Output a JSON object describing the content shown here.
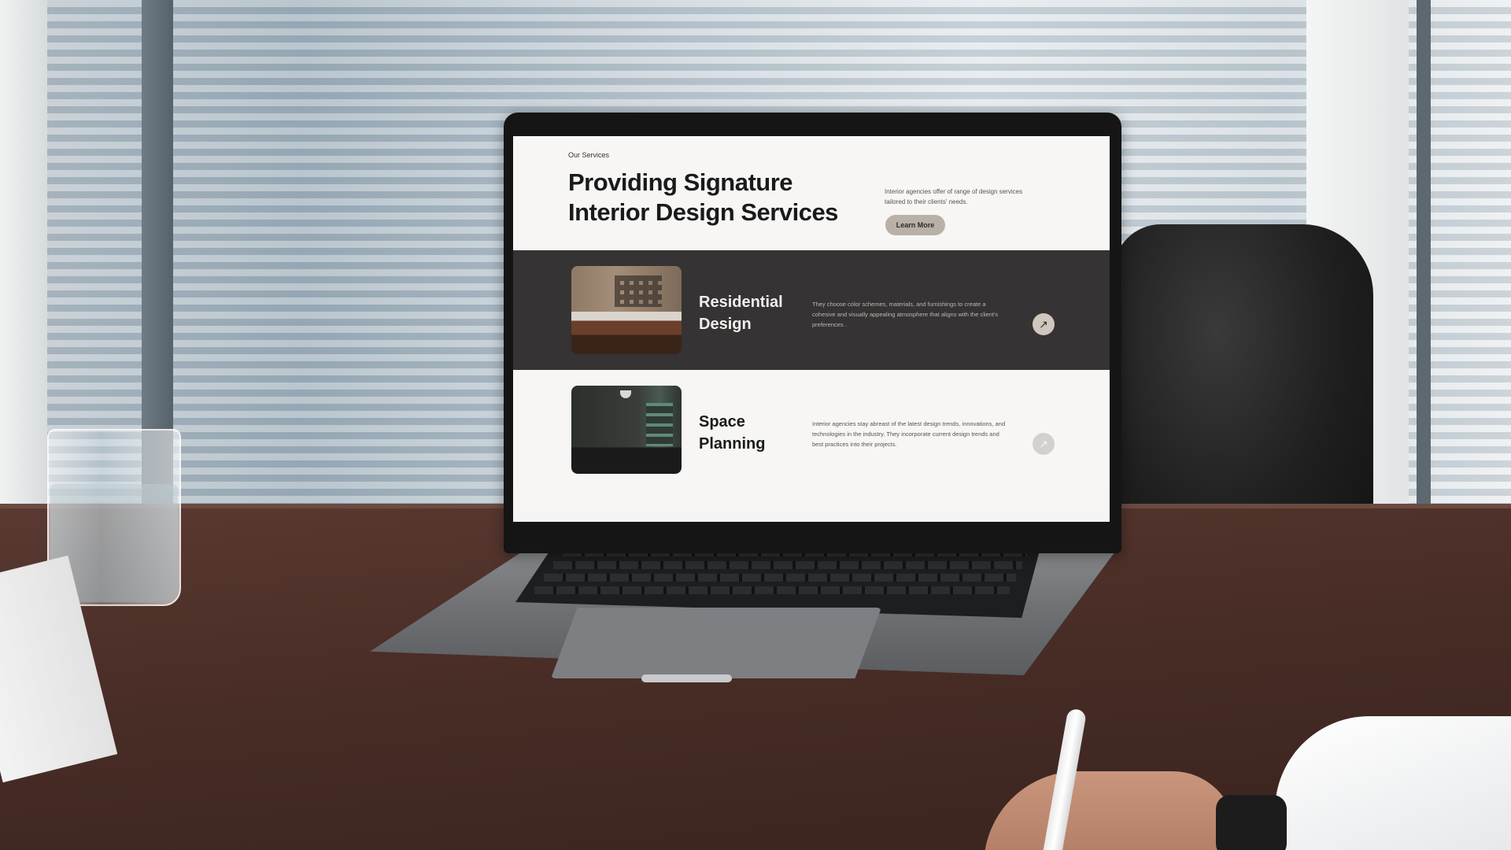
{
  "page": {
    "eyebrow": "Our Services",
    "title": "Providing Signature Interior Design Services",
    "description": "Interior agencies offer of range of design services tailored to their clients' needs.",
    "cta_label": "Learn More"
  },
  "services": [
    {
      "title": "Residential Design",
      "description": "They choose color schemes, materials, and furnishings to create a cohesive and visually appealing atmosphere that aligns with the client's preferences .",
      "arrow_icon": "arrow-up-right-icon"
    },
    {
      "title": "Space Planning",
      "description": "Interior agencies stay abreast of the latest design trends, innovations, and technologies in the industry. They incorporate current design trends and best practices into their projects.",
      "arrow_icon": "arrow-up-right-icon"
    }
  ],
  "colors": {
    "page_bg": "#f7f6f4",
    "dark_card": "#353333",
    "accent_button": "#b9b0a7",
    "text_dark": "#1a1a1a"
  }
}
